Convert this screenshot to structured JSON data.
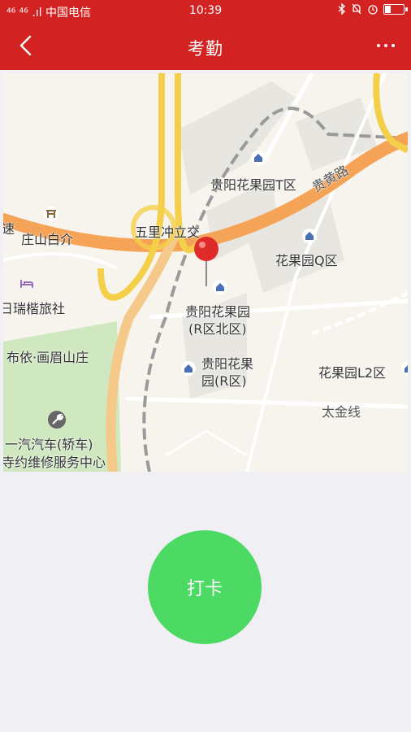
{
  "status_bar": {
    "left": "⁴⁶ ⁴⁶ .ıl 中国电信",
    "time": "10:39"
  },
  "nav": {
    "title": "考勤"
  },
  "map": {
    "labels": {
      "guiyang_huaguoyuan_t": "贵阳花果园T区",
      "guihuang_road": "贵黄路",
      "wulichong": "五里冲立交",
      "zhuangshan": "庄山白介",
      "huaguoyuan_q": "花果园Q区",
      "ruikai_hotel": "日瑞楷旅社",
      "guiyang_huaguoyuan_r_north_1": "贵阳花果园",
      "guiyang_huaguoyuan_r_north_2": "(R区北区)",
      "buyi": "布依·画眉山庄",
      "guiyang_huaguoyuan_r_1": "贵阳花果",
      "guiyang_huaguoyuan_r_2": "园(R区)",
      "huaguoyuan_l2": "花果园L2区",
      "taijin_line": "太金线",
      "faw_1": "一汽汽车(轿车)",
      "faw_2": "寺约维修服务中心",
      "edge_left": "速"
    },
    "colors": {
      "main_road": "#f5a356",
      "yellow_road": "#f4d04a",
      "pin": "#e02b2b",
      "green_area": "#cfe8c0"
    }
  },
  "action": {
    "punch_label": "打卡",
    "button_color": "#4cd964"
  }
}
